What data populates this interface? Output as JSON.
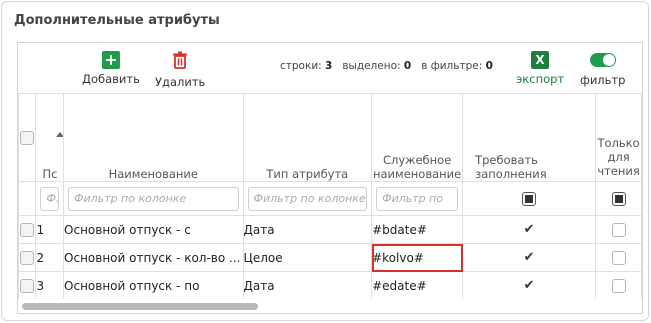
{
  "panel": {
    "title": "Дополнительные атрибуты"
  },
  "toolbar": {
    "add_label": "Добавить",
    "delete_label": "Удалить",
    "rows_label": "строки:",
    "rows_value": "3",
    "selected_label": "выделено:",
    "selected_value": "0",
    "filtered_label": "в фильтре:",
    "filtered_value": "0",
    "export_label": "экспорт",
    "export_icon": "X",
    "filter_label": "фильтр",
    "add_icon": "+",
    "colors": {
      "add": "#1f9d4a",
      "delete": "#d9302e",
      "excel": "#1e7e3e",
      "toggle": "#1f9d4a",
      "highlight": "#d9302e"
    }
  },
  "columns": {
    "num": "Пс",
    "name": "Наименование",
    "type": "Тип атрибута",
    "service_name": "Служебное наименование",
    "required": "Требовать заполнения",
    "readonly": "Только для чтения"
  },
  "filters": {
    "num_placeholder": "Ф.",
    "name_placeholder": "Фильтр по колонке",
    "type_placeholder": "Фильтр по колонке",
    "service_placeholder": "Фильтр по"
  },
  "rows": [
    {
      "num": "1",
      "name": "Основной отпуск - с",
      "type": "Дата",
      "service": "#bdate#",
      "required": true,
      "readonly": false
    },
    {
      "num": "2",
      "name": "Основной отпуск - кол-во ...",
      "type": "Целое",
      "service": "#kolvo#",
      "required": true,
      "readonly": false
    },
    {
      "num": "3",
      "name": "Основной отпуск - по",
      "type": "Дата",
      "service": "#edate#",
      "required": true,
      "readonly": false
    }
  ]
}
